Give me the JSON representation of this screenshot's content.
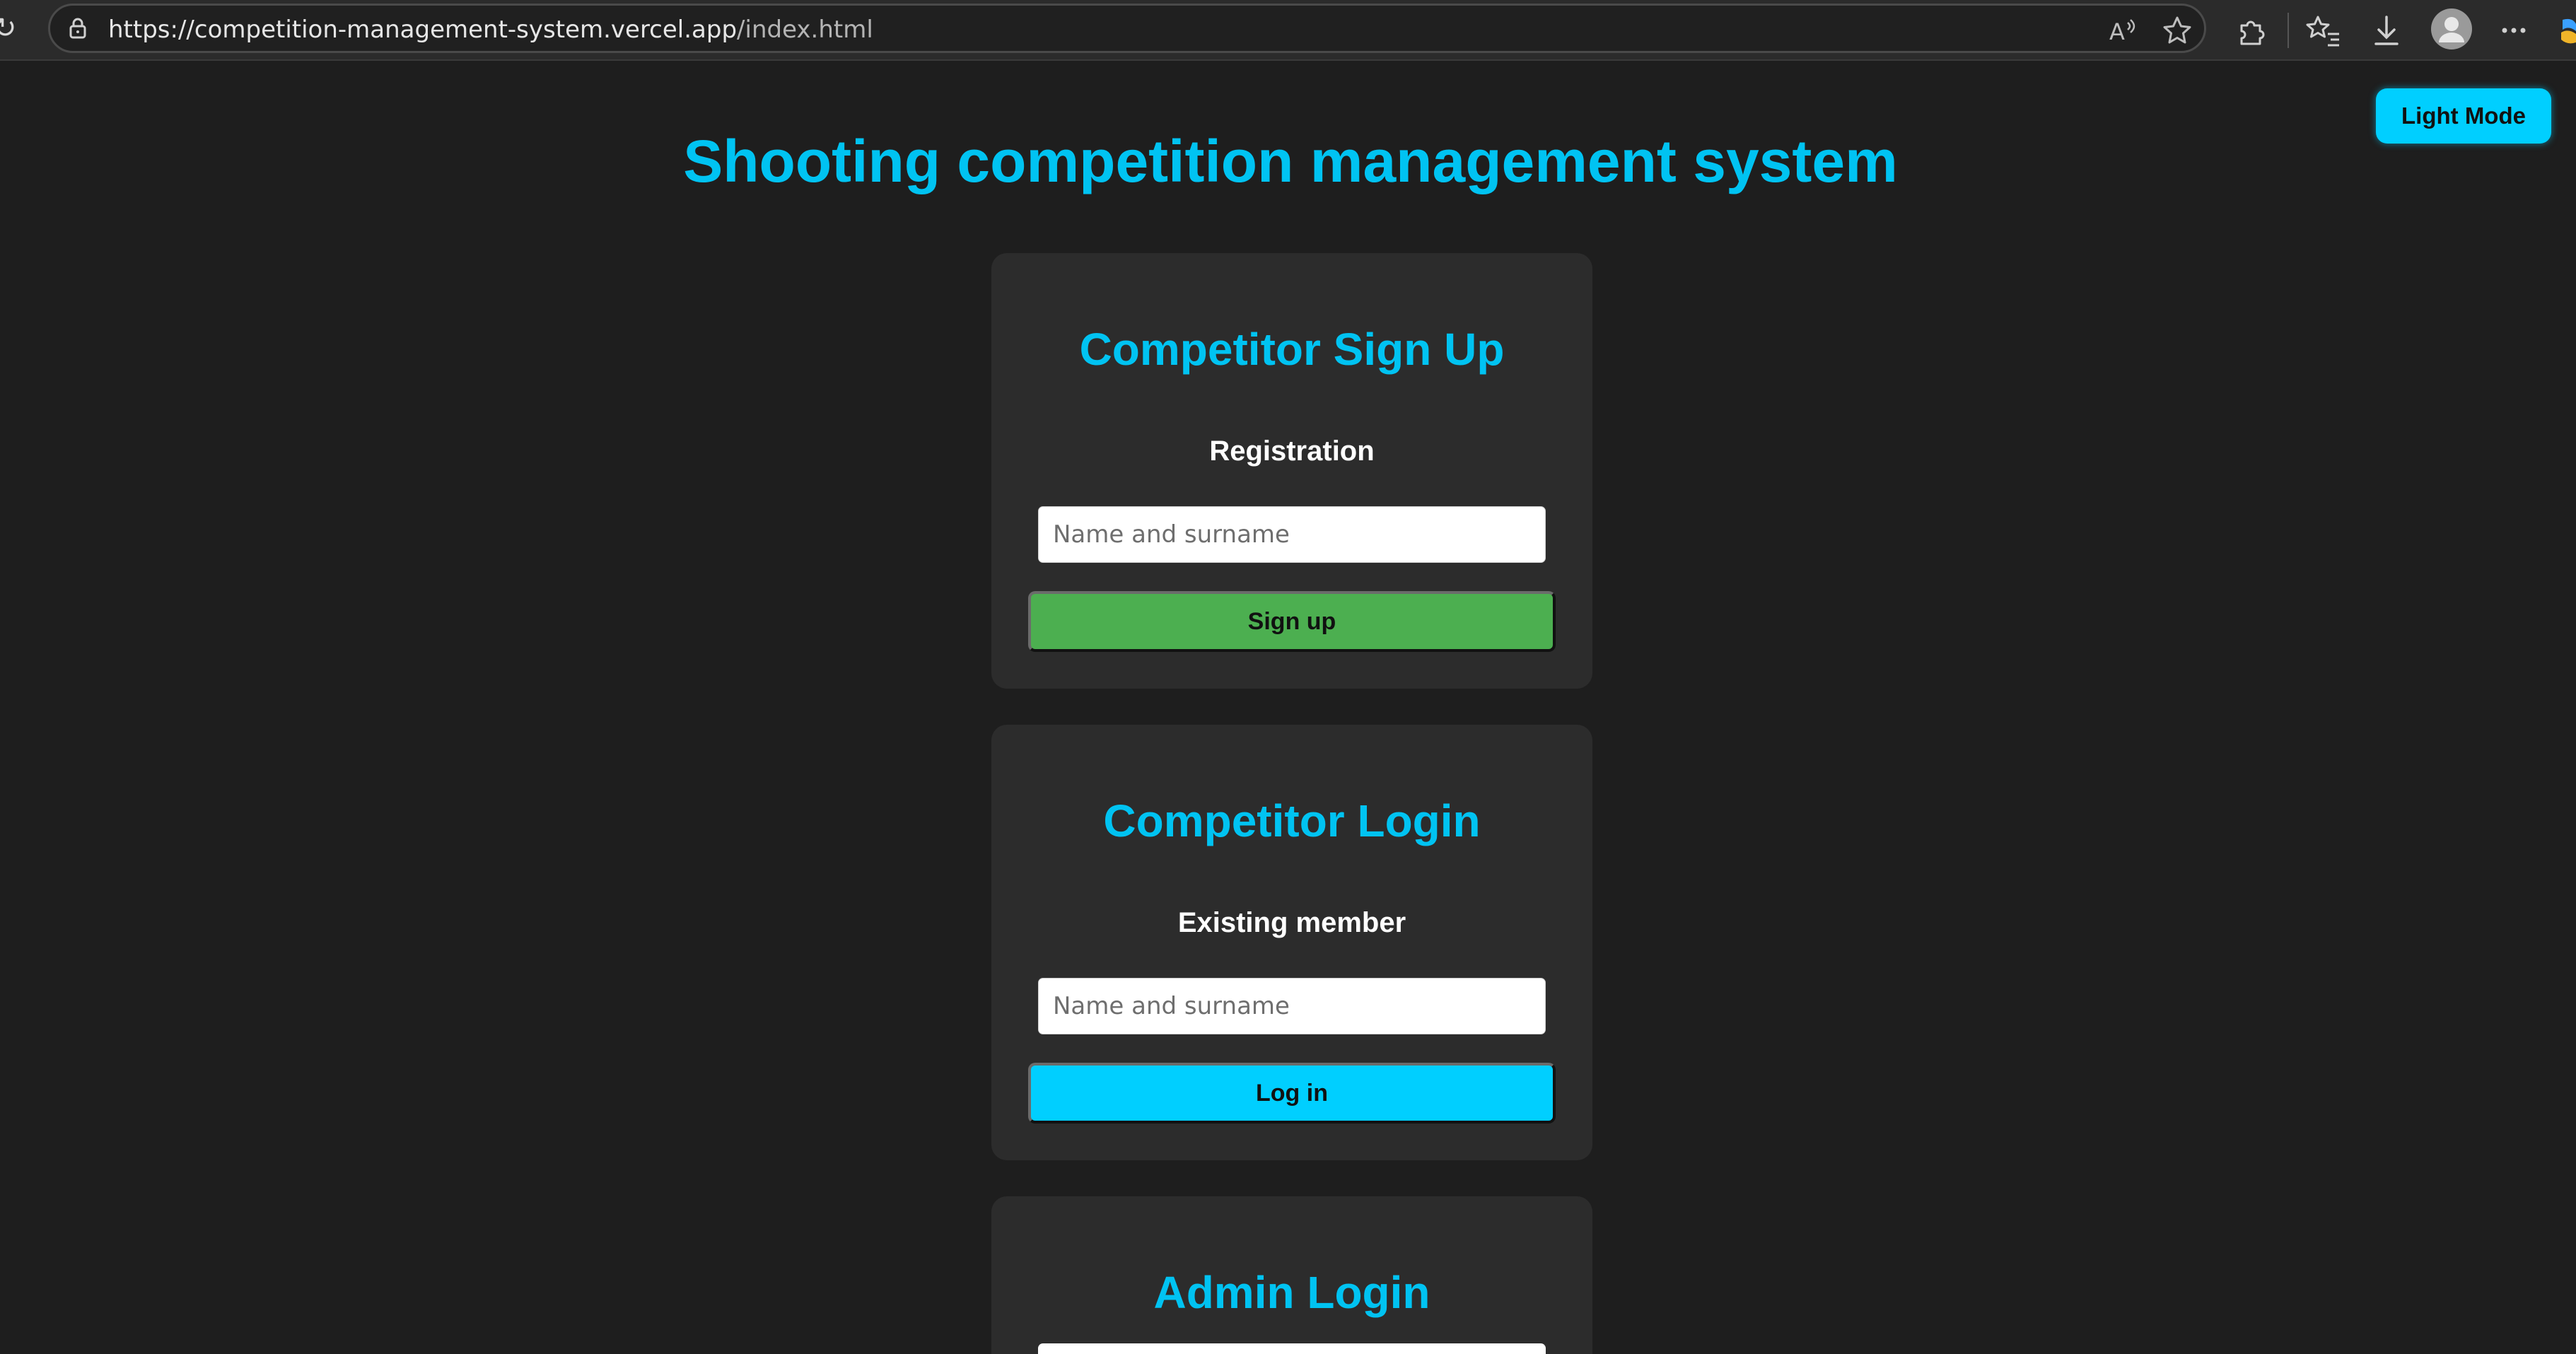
{
  "browser": {
    "url_base": "https://competition-management-system.vercel.app",
    "url_path": "/index.html",
    "icons": [
      "reload-icon",
      "lock-icon",
      "read-aloud-icon",
      "favorite-star-icon",
      "extensions-icon",
      "favorites-list-icon",
      "download-icon",
      "profile-avatar-icon",
      "more-options-icon",
      "copilot-icon"
    ]
  },
  "theme_toggle": {
    "label": "Light Mode"
  },
  "page": {
    "title": "Shooting competition management system"
  },
  "signup": {
    "title": "Competitor Sign Up",
    "subtitle": "Registration",
    "name_placeholder": "Name and surname",
    "button_label": "Sign up"
  },
  "login": {
    "title": "Competitor Login",
    "subtitle": "Existing member",
    "name_placeholder": "Name and surname",
    "button_label": "Log in"
  },
  "admin": {
    "title": "Admin Login"
  },
  "colors": {
    "background": "#1e1e1e",
    "card": "#2c2c2c",
    "accent": "#00c3f2",
    "signup_button": "#4caf50",
    "login_button": "#00cfff"
  }
}
